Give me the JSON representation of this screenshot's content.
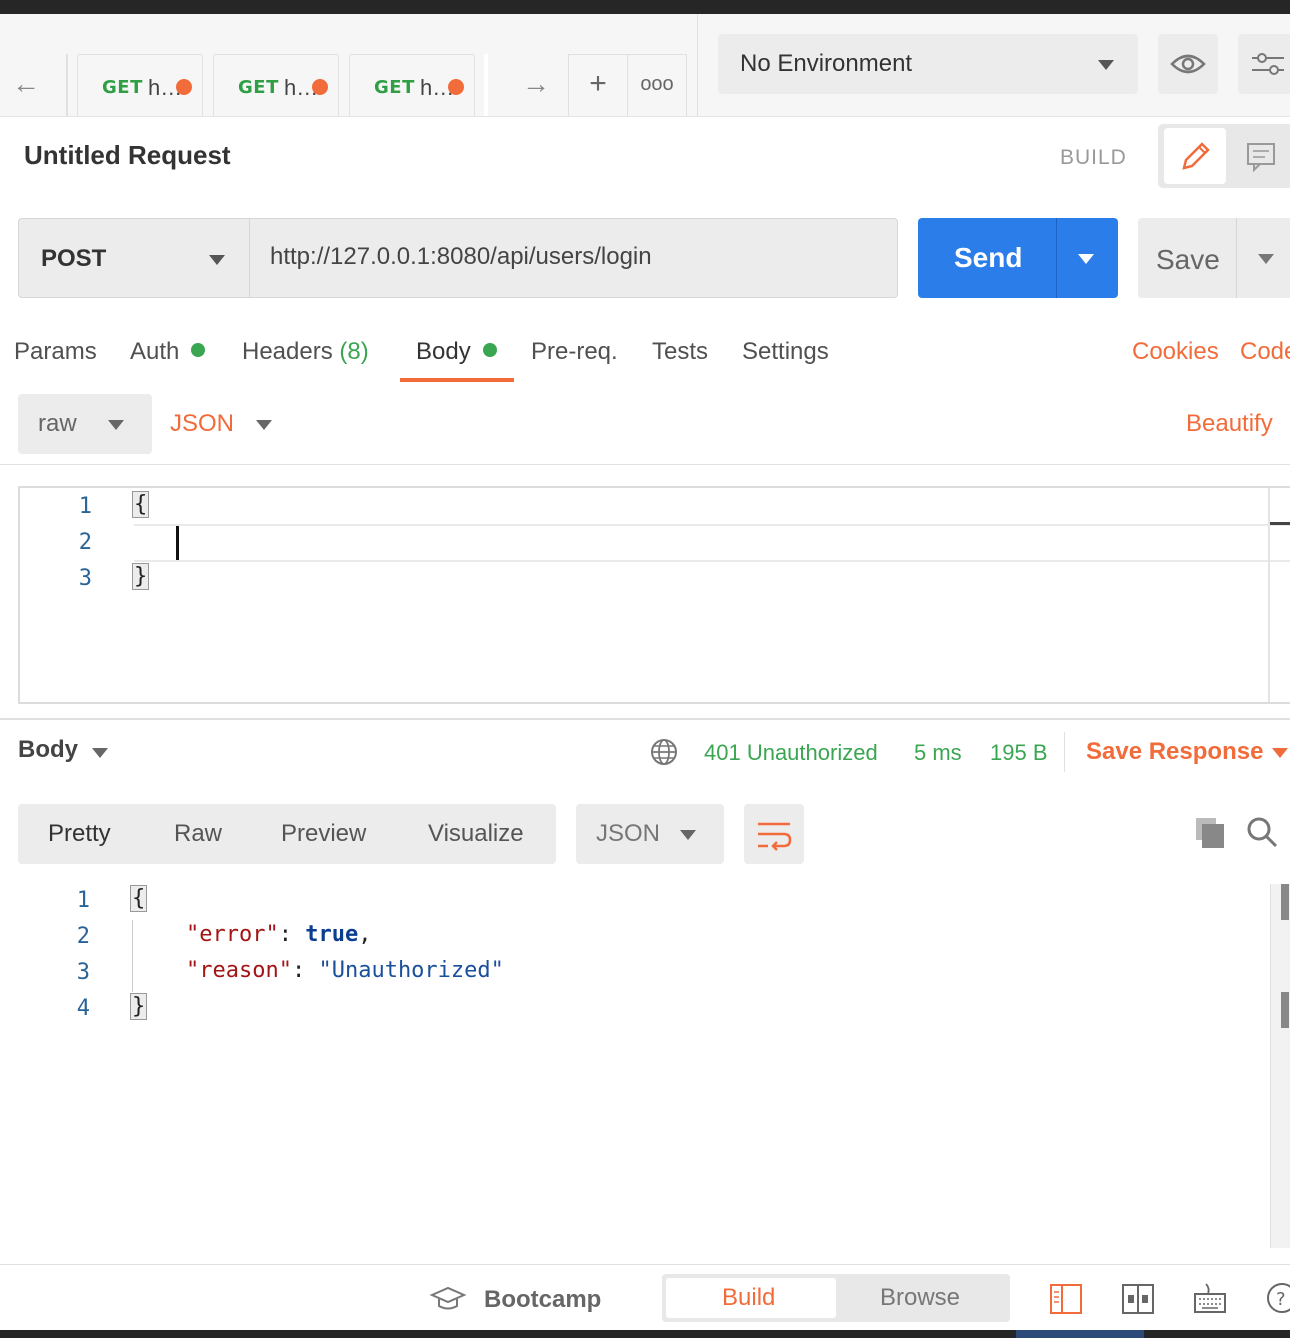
{
  "tabs": [
    {
      "method": "GET",
      "name": "h…"
    },
    {
      "method": "GET",
      "name": "h…"
    },
    {
      "method": "GET",
      "name": "h…"
    }
  ],
  "environment": {
    "selected": "No Environment"
  },
  "request": {
    "title": "Untitled Request",
    "mode_label": "BUILD",
    "method": "POST",
    "url": "http://127.0.0.1:8080/api/users/login",
    "send_label": "Send",
    "save_label": "Save"
  },
  "request_tabs": {
    "params": "Params",
    "auth": "Auth",
    "headers": "Headers",
    "headers_count": "(8)",
    "body": "Body",
    "prereq": "Pre-req.",
    "tests": "Tests",
    "settings": "Settings",
    "cookies": "Cookies",
    "code": "Code"
  },
  "body_options": {
    "mode": "raw",
    "format": "JSON",
    "beautify": "Beautify"
  },
  "request_editor": {
    "line_numbers": [
      "1",
      "2",
      "3"
    ],
    "open_brace": "{",
    "close_brace": "}"
  },
  "response": {
    "section_label": "Body",
    "status": "401 Unauthorized",
    "time": "5 ms",
    "size": "195 B",
    "save_response": "Save Response",
    "view_tabs": {
      "pretty": "Pretty",
      "raw": "Raw",
      "preview": "Preview",
      "visualize": "Visualize"
    },
    "format": "JSON",
    "line_numbers": [
      "1",
      "2",
      "3",
      "4"
    ],
    "open_brace": "{",
    "close_brace": "}",
    "key_error": "\"error\"",
    "val_error": "true",
    "key_reason": "\"reason\"",
    "val_reason": "\"Unauthorized\"",
    "colon": ":",
    "comma": ","
  },
  "footer": {
    "bootcamp": "Bootcamp",
    "build": "Build",
    "browse": "Browse"
  },
  "colors": {
    "accent": "#f26b3a",
    "send": "#2b7de9",
    "success": "#3aa652"
  }
}
